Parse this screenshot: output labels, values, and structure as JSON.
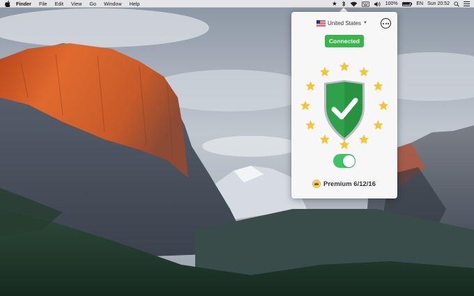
{
  "menubar": {
    "app_name": "Finder",
    "menus": [
      "File",
      "Edit",
      "View",
      "Go",
      "Window",
      "Help"
    ],
    "battery_percent": "100%",
    "input_source": "EN",
    "clock": "Sun 20:52"
  },
  "vpn_popover": {
    "country": "United States",
    "status": "Connected",
    "vpn_enabled": true,
    "subscription": "Premium 6/12/16"
  },
  "colors": {
    "connected_green": "#39b54a",
    "toggle_green": "#3cc465",
    "shield_green": "#2ea24a",
    "star_gold": "#f4c531"
  },
  "icons": [
    "apple-logo-icon",
    "star-icon",
    "bluetooth-icon",
    "wifi-icon",
    "keyboard-icon",
    "volume-icon",
    "battery-icon",
    "list-icon",
    "us-flag-icon",
    "more-options-icon",
    "shield-check-icon",
    "crown-icon"
  ]
}
